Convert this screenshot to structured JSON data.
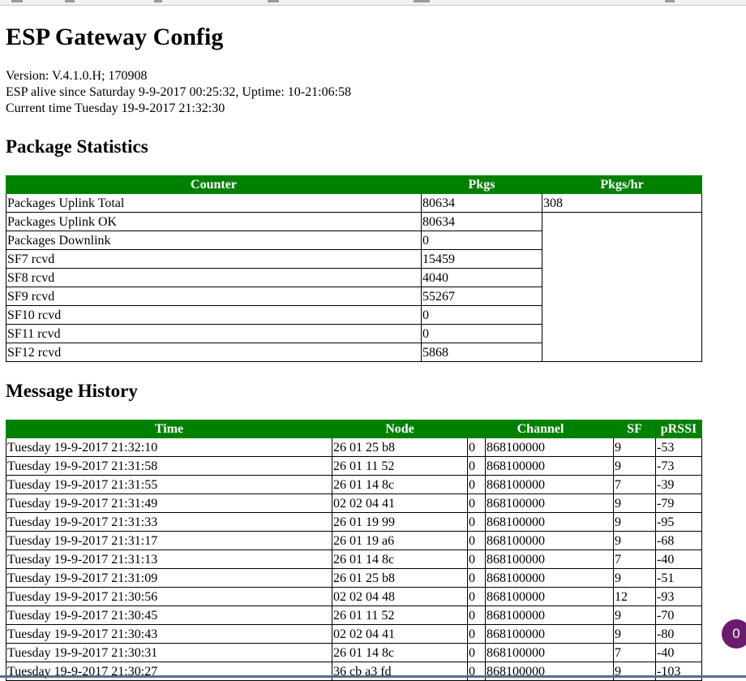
{
  "title": "ESP Gateway Config",
  "meta": {
    "version": "Version: V.4.1.0.H; 170908",
    "alive": "ESP alive since Saturday 9-9-2017 00:25:32, Uptime: 10-21:06:58",
    "current_time": "Current time Tuesday 19-9-2017 21:32:30"
  },
  "stats": {
    "heading": "Package Statistics",
    "columns": [
      "Counter",
      "Pkgs",
      "Pkgs/hr"
    ],
    "pkgs_per_hr": "308",
    "rows": [
      {
        "counter": "Packages Uplink Total",
        "pkgs": "80634"
      },
      {
        "counter": "Packages Uplink OK",
        "pkgs": "80634"
      },
      {
        "counter": "Packages Downlink",
        "pkgs": "0"
      },
      {
        "counter": "SF7 rcvd",
        "pkgs": "15459"
      },
      {
        "counter": "SF8 rcvd",
        "pkgs": "4040"
      },
      {
        "counter": "SF9 rcvd",
        "pkgs": "55267"
      },
      {
        "counter": "SF10 rcvd",
        "pkgs": "0"
      },
      {
        "counter": "SF11 rcvd",
        "pkgs": "0"
      },
      {
        "counter": "SF12 rcvd",
        "pkgs": "5868"
      }
    ]
  },
  "history": {
    "heading": "Message History",
    "columns": [
      "Time",
      "Node",
      "Channel",
      "SF",
      "pRSSI"
    ],
    "rows": [
      {
        "time": "Tuesday 19-9-2017 21:32:10",
        "node": "26 01 25 b8",
        "ch": "0",
        "freq": "868100000",
        "sf": "9",
        "prssi": "-53"
      },
      {
        "time": "Tuesday 19-9-2017 21:31:58",
        "node": "26 01 11 52",
        "ch": "0",
        "freq": "868100000",
        "sf": "9",
        "prssi": "-73"
      },
      {
        "time": "Tuesday 19-9-2017 21:31:55",
        "node": "26 01 14 8c",
        "ch": "0",
        "freq": "868100000",
        "sf": "7",
        "prssi": "-39"
      },
      {
        "time": "Tuesday 19-9-2017 21:31:49",
        "node": "02 02 04 41",
        "ch": "0",
        "freq": "868100000",
        "sf": "9",
        "prssi": "-79"
      },
      {
        "time": "Tuesday 19-9-2017 21:31:33",
        "node": "26 01 19 99",
        "ch": "0",
        "freq": "868100000",
        "sf": "9",
        "prssi": "-95"
      },
      {
        "time": "Tuesday 19-9-2017 21:31:17",
        "node": "26 01 19 a6",
        "ch": "0",
        "freq": "868100000",
        "sf": "9",
        "prssi": "-68"
      },
      {
        "time": "Tuesday 19-9-2017 21:31:13",
        "node": "26 01 14 8c",
        "ch": "0",
        "freq": "868100000",
        "sf": "7",
        "prssi": "-40"
      },
      {
        "time": "Tuesday 19-9-2017 21:31:09",
        "node": "26 01 25 b8",
        "ch": "0",
        "freq": "868100000",
        "sf": "9",
        "prssi": "-51"
      },
      {
        "time": "Tuesday 19-9-2017 21:30:56",
        "node": "02 02 04 48",
        "ch": "0",
        "freq": "868100000",
        "sf": "12",
        "prssi": "-93"
      },
      {
        "time": "Tuesday 19-9-2017 21:30:45",
        "node": "26 01 11 52",
        "ch": "0",
        "freq": "868100000",
        "sf": "9",
        "prssi": "-70"
      },
      {
        "time": "Tuesday 19-9-2017 21:30:43",
        "node": "02 02 04 41",
        "ch": "0",
        "freq": "868100000",
        "sf": "9",
        "prssi": "-80"
      },
      {
        "time": "Tuesday 19-9-2017 21:30:31",
        "node": "26 01 14 8c",
        "ch": "0",
        "freq": "868100000",
        "sf": "7",
        "prssi": "-40"
      },
      {
        "time": "Tuesday 19-9-2017 21:30:27",
        "node": "36 cb a3 fd",
        "ch": "0",
        "freq": "868100000",
        "sf": "9",
        "prssi": "-103"
      }
    ]
  },
  "chat_badge": "0",
  "colors": {
    "header_bg": "#008000",
    "header_text": "#ffffff",
    "badge_bg": "#6a1b6e"
  }
}
